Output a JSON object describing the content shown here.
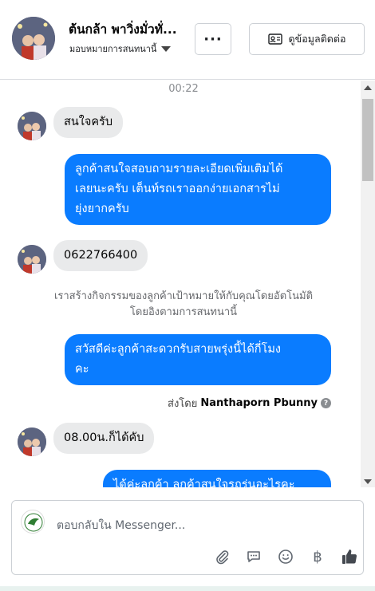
{
  "header": {
    "name": "ต้นกล้า พาวิ่งมั่วทั่...",
    "subtitle": "มอบหมายการสนทนานี้",
    "more_label": "···",
    "contact_label": "ดูข้อมูลติดต่อ"
  },
  "conversation": {
    "timestamp": "00:22",
    "messages": [
      {
        "direction": "in",
        "lines": [
          "สนใจครับ"
        ]
      },
      {
        "direction": "out",
        "lines": [
          "ลูกค้าสนใจสอบถามรายละเอียดเพิ่มเติมได้",
          "เลยนะครับ เต็นท์รถเราออกง่ายเอกสารไม่",
          "ยุ่งยากครับ"
        ]
      },
      {
        "direction": "in",
        "lines": [
          "0622766400"
        ]
      },
      {
        "direction": "system",
        "lines": [
          "เราสร้างกิจกรรมของลูกค้าเป้าหมายให้กับคุณโดยอัตโนมัติ",
          "โดยอิงตามการสนทนานี้"
        ]
      },
      {
        "direction": "out",
        "lines": [
          "สวัสดีค่ะลูกค้าสะดวกรับสายพรุ่งนี้ได้กี่โมง",
          "คะ"
        ]
      },
      {
        "direction": "in",
        "lines": [
          "08.00น.ก็ได้คับ"
        ]
      },
      {
        "direction": "out",
        "lines": [
          "ได้ค่ะลูกค้า ลูกค้าสนใจรถรุ่นอะไรคะ"
        ]
      }
    ],
    "sent_by_prefix": "ส่งโดย",
    "sent_by_name": "Nanthaporn Pbunny",
    "help_icon": "?"
  },
  "composer": {
    "placeholder": "ตอบกลับใน Messenger...",
    "tools": [
      {
        "icon": "paperclip-icon",
        "glyph": "📎"
      },
      {
        "icon": "chat-bubble-icon",
        "glyph": "💬"
      },
      {
        "icon": "smiley-icon",
        "glyph": "☺"
      },
      {
        "icon": "baht-icon",
        "glyph": "฿"
      },
      {
        "icon": "thumbs-up-icon",
        "glyph": "👍"
      }
    ]
  },
  "colors": {
    "outgoing_bubble": "#0a7cff",
    "incoming_bubble": "#e9eaeb"
  }
}
